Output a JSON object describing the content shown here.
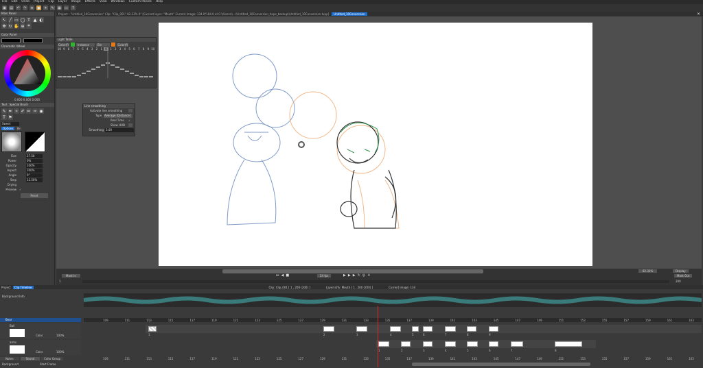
{
  "menu": [
    "File",
    "Edit",
    "Undo",
    "Project",
    "Clip",
    "Layer",
    "Image",
    "Effects",
    "View",
    "Windows",
    "Custom Panels",
    "Help"
  ],
  "tabs": {
    "project_tab": "Project : \"Untitled_10Conversion\"  Clip: \"Clip_001\"  82.33%  0°  [Current layer: \"Mouth\"  Current image: 134.0*184.0 at C:\\\\Users\\\\...\\\\Untitled_10Conversion_hope_backup\\\\Untitled_10Conversion.tvpp]",
    "doc_tab": "Untitled_10Conversion"
  },
  "left": {
    "main_panel": "Main Panel",
    "color_panel": "Color Panel",
    "chromatic": "Chromatic Wheel",
    "color_values": "0.000  0.000  0.000",
    "tool_panel": "Tool : Special Brush",
    "preset": "Sweet",
    "tabs": [
      "Options",
      "Bin"
    ],
    "brush_props": [
      {
        "label": "Size",
        "value": "27.50"
      },
      {
        "label": "Power",
        "value": "0%"
      },
      {
        "label": "Opacity",
        "value": "100%"
      },
      {
        "label": "Aspect",
        "value": "100%"
      },
      {
        "label": "Angle",
        "value": "0°"
      },
      {
        "label": "Step",
        "value": "12.50%"
      },
      {
        "label": "Drying",
        "value": ""
      },
      {
        "label": "Preview",
        "value": "✓"
      }
    ],
    "reset": "Reset"
  },
  "lighttable": {
    "title": "Light Table",
    "instance": "Instance",
    "bin": "Bin",
    "color_left": "Color(f)",
    "color_right": "Color(f)",
    "numbers": [
      "10",
      "9",
      "8",
      "7",
      "6",
      "5",
      "4",
      "3",
      "2",
      "1",
      "0",
      "1",
      "2",
      "3",
      "4",
      "5",
      "6",
      "7",
      "8",
      "9",
      "10"
    ]
  },
  "linesmooth": {
    "title": "Line smoothing",
    "activate": "Activate line smoothing",
    "type_label": "Type",
    "type_value": "Average (Distance)",
    "realtime": "Real Time",
    "realtime_value": "✓",
    "showhud": "Show HUD",
    "smoothing_label": "Smoothing",
    "smoothing_value": "3.00"
  },
  "bottom": {
    "mark_in": "Mark In",
    "mark_in_val": "1",
    "fps": "24 fps",
    "zoom": "82.33%",
    "display": "Display",
    "mark_out": "Mark Out",
    "mark_out_val": "200"
  },
  "timeline": {
    "project_tab": "Project",
    "clip_tab": "Clip Timeline",
    "clip_info": "Clip: Clip_001 [ 1 , 200 (200) ]",
    "layer_info": "Layer(s)%: Mouth [ 1 , 200 (200) ]",
    "current_image": "Current image: 134",
    "background_info": "Background Info",
    "layer_bar": "Bear",
    "layers": [
      {
        "name": "Ball",
        "color_label": "Color",
        "opacity": "100%"
      },
      {
        "name": "arms",
        "color_label": "Color",
        "opacity": "100%"
      }
    ],
    "bottom_tabs": [
      "Notes",
      "Sound",
      "Color Group"
    ],
    "background": "Background",
    "start_frame": "Start Frame",
    "ruler": [
      "109",
      "111",
      "113",
      "115",
      "117",
      "119",
      "121",
      "123",
      "125",
      "127",
      "129",
      "131",
      "133",
      "135",
      "137",
      "139",
      "141",
      "143",
      "145",
      "147",
      "149",
      "151",
      "153",
      "155",
      "157",
      "159",
      "161",
      "163"
    ],
    "current_frame": "134",
    "frame_labels_1": [
      "1",
      "2",
      "3",
      "4",
      "5",
      "6",
      "7",
      "8",
      "9"
    ],
    "frame_labels_2": [
      "1",
      "2",
      "3",
      "4",
      "5",
      "6",
      "7",
      "8"
    ]
  },
  "colors": {
    "accent": "#3a7fd5",
    "green": "#2fb52f",
    "orange": "#e07a1a",
    "current": "#d03030"
  }
}
